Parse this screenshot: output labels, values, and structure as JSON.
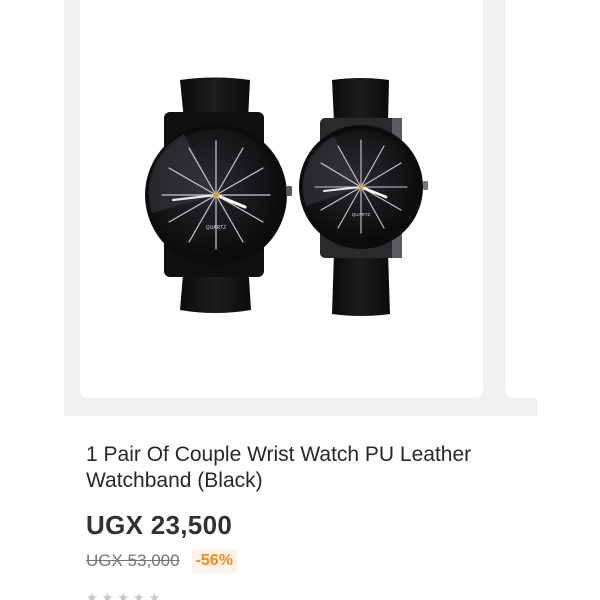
{
  "product": {
    "title": "1 Pair Of Couple Wrist Watch PU Leather Watchband (Black)",
    "price": "UGX 23,500",
    "old_price": "UGX 53,000",
    "discount": "-56%",
    "image_icon": "watch-pair-image",
    "dial_brand": "QUARTZ",
    "rating": {
      "stars": 5,
      "icon": "star-icon"
    }
  },
  "colors": {
    "discount": "#f68b1e",
    "discount_bg": "#fef3e9",
    "gallery_bg": "#f1f1f2"
  }
}
